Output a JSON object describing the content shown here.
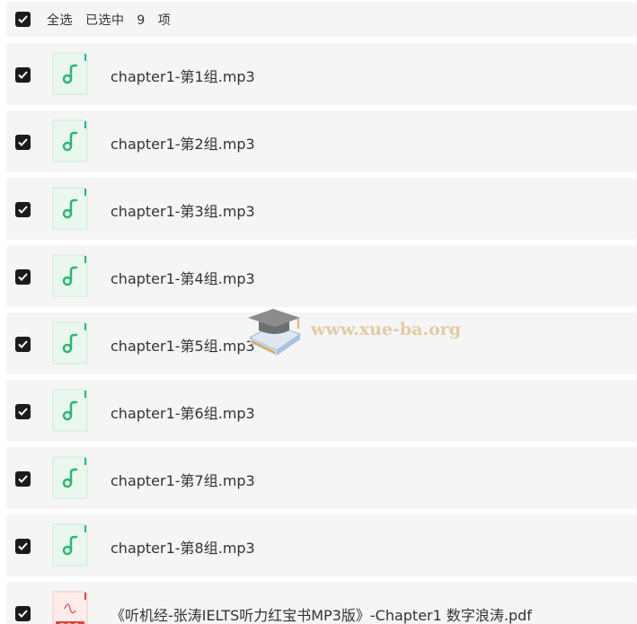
{
  "header": {
    "select_all_label": "全选",
    "selected_prefix": "已选中",
    "selected_count": "9",
    "selected_suffix": "项"
  },
  "files": [
    {
      "name": "chapter1-第1组.mp3",
      "icon": "audio-file-icon",
      "checked": true
    },
    {
      "name": "chapter1-第2组.mp3",
      "icon": "audio-file-icon",
      "checked": true
    },
    {
      "name": "chapter1-第3组.mp3",
      "icon": "audio-file-icon",
      "checked": true
    },
    {
      "name": "chapter1-第4组.mp3",
      "icon": "audio-file-icon",
      "checked": true
    },
    {
      "name": "chapter1-第5组.mp3",
      "icon": "audio-file-icon",
      "checked": true
    },
    {
      "name": "chapter1-第6组.mp3",
      "icon": "audio-file-icon",
      "checked": true
    },
    {
      "name": "chapter1-第7组.mp3",
      "icon": "audio-file-icon",
      "checked": true
    },
    {
      "name": "chapter1-第8组.mp3",
      "icon": "audio-file-icon",
      "checked": true
    },
    {
      "name": "《听机经-张涛IELTS听力红宝书MP3版》-Chapter1 数字浪涛.pdf",
      "icon": "pdf-file-icon",
      "checked": true
    }
  ],
  "watermark": {
    "text": "www.xue-ba.org",
    "icon": "graduation-cap-icon"
  },
  "colors": {
    "row_background": "#f5f5f5",
    "checkbox": "#1b1b1b",
    "audio_accent": "#2bb673",
    "pdf_accent": "#e0443e",
    "watermark_text": "#e0c79c"
  }
}
